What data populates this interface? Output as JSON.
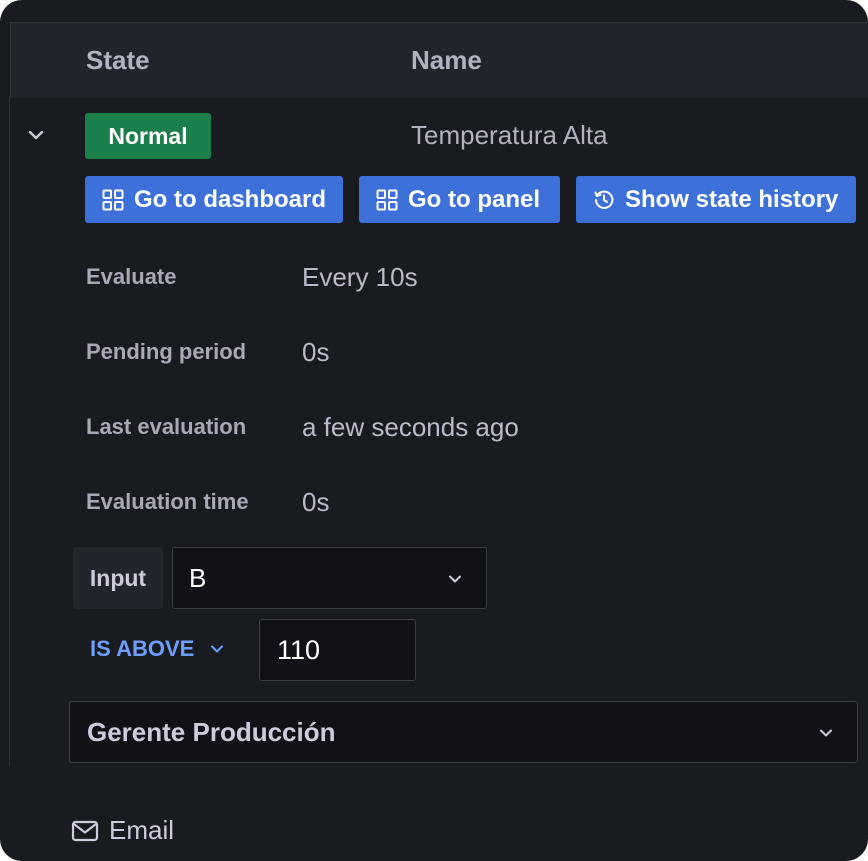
{
  "table_header": {
    "state": "State",
    "name": "Name"
  },
  "rule": {
    "state_badge": "Normal",
    "name": "Temperatura Alta",
    "state_color": "#1a7f4b"
  },
  "actions": {
    "dashboard": "Go to dashboard",
    "panel": "Go to panel",
    "history": "Show state history"
  },
  "details": [
    {
      "label": "Evaluate",
      "value": "Every 10s"
    },
    {
      "label": "Pending period",
      "value": "0s"
    },
    {
      "label": "Last evaluation",
      "value": "a few seconds ago"
    },
    {
      "label": "Evaluation time",
      "value": "0s"
    }
  ],
  "condition": {
    "input_label": "Input",
    "input_value": "B",
    "operator": "IS ABOVE",
    "threshold": "110"
  },
  "contact_point": {
    "value": "Gerente Producción"
  },
  "notification": {
    "email_label": "Email"
  },
  "colors": {
    "background": "#181b1f",
    "primary_button": "#3d71d9",
    "link_blue": "#6e9fff"
  }
}
